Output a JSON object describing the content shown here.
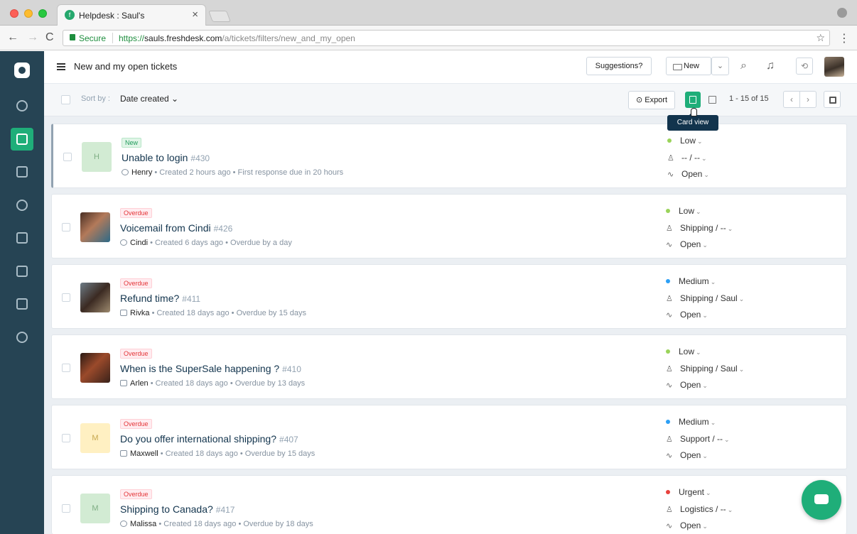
{
  "browser": {
    "tab_title": "Helpdesk : Saul's",
    "tab_close": "×",
    "secure_label": "Secure",
    "url_scheme": "https://",
    "url_host": "sauls.freshdesk.com",
    "url_path": "/a/tickets/filters/new_and_my_open",
    "back": "←",
    "forward": "→",
    "reload": "C",
    "star": "☆",
    "menu": "⋮"
  },
  "header": {
    "title": "New and my open tickets",
    "suggestions_label": "Suggestions?",
    "new_label": "New",
    "new_caret": "⌄",
    "search_icon": "⌕",
    "bell_icon": "♫",
    "sync_icon": "⟲"
  },
  "filterbar": {
    "sort_label": "Sort by :",
    "sort_value": "Date created ⌄",
    "export_label": "⊙ Export",
    "pagination": "1 - 15 of 15",
    "prev": "‹",
    "next": "›",
    "tooltip": "Card view"
  },
  "tickets": [
    {
      "avatar": "H",
      "badge": "New",
      "subject": "Unable to login",
      "id": "#430",
      "requester": "Henry",
      "meta": " • Created 2 hours ago • First response due in 20 hours",
      "priority": "Low",
      "group": "-- / --",
      "status": "Open"
    },
    {
      "avatar": "",
      "badge": "Overdue",
      "subject": "Voicemail from Cindi",
      "id": "#426",
      "requester": "Cindi",
      "meta": " • Created 6 days ago • Overdue by a day",
      "priority": "Low",
      "group": "Shipping / --",
      "status": "Open"
    },
    {
      "avatar": "",
      "badge": "Overdue",
      "subject": "Refund time?",
      "id": "#411",
      "requester": "Rivka",
      "meta": " • Created 18 days ago • Overdue by 15 days",
      "priority": "Medium",
      "group": "Shipping / Saul",
      "status": "Open"
    },
    {
      "avatar": "",
      "badge": "Overdue",
      "subject": "When is the SuperSale happening ?",
      "id": "#410",
      "requester": "Arlen",
      "meta": " • Created 18 days ago • Overdue by 13 days",
      "priority": "Low",
      "group": "Shipping / Saul",
      "status": "Open"
    },
    {
      "avatar": "M",
      "badge": "Overdue",
      "subject": "Do you offer international shipping?",
      "id": "#407",
      "requester": "Maxwell",
      "meta": " • Created 18 days ago • Overdue by 15 days",
      "priority": "Medium",
      "group": "Support / --",
      "status": "Open"
    },
    {
      "avatar": "M",
      "badge": "Overdue",
      "subject": "Shipping to Canada?",
      "id": "#417",
      "requester": "Malissa",
      "meta": " • Created 18 days ago • Overdue by 18 days",
      "priority": "Urgent",
      "group": "Logistics / --",
      "status": "Open"
    }
  ],
  "colors": {
    "accent": "#1fae79",
    "sidebar": "#264454",
    "priority_low": "#9ad35a",
    "priority_medium": "#2c9ff5",
    "priority_urgent": "#e8413c"
  },
  "icons": {
    "sidebar": [
      "freshdesk-logo-icon",
      "dashboard-icon",
      "tickets-icon",
      "contacts-icon",
      "social-icon",
      "solutions-icon",
      "forums-icon",
      "reports-icon",
      "admin-gear-icon"
    ],
    "fab": "chat-bubble-icon"
  }
}
